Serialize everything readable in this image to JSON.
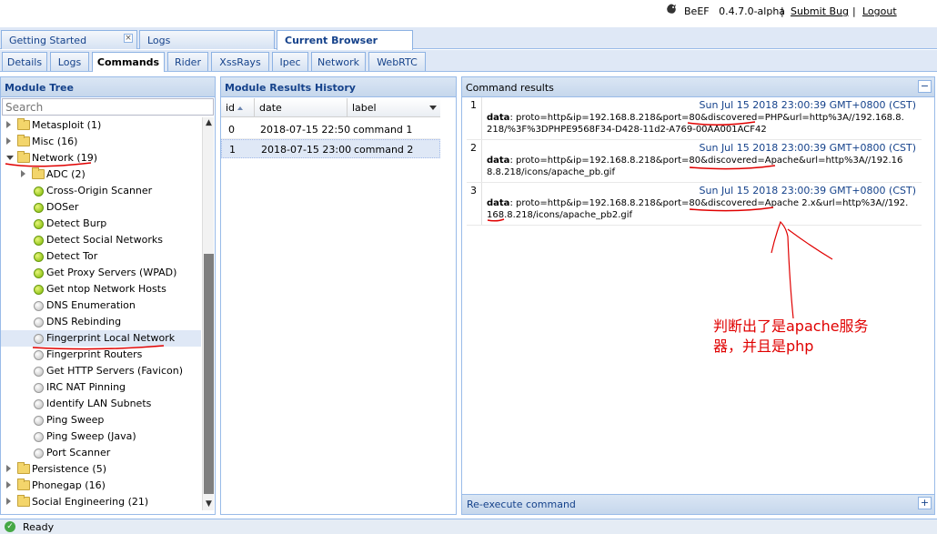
{
  "header": {
    "brand": "BeEF",
    "version": "0.4.7.0-alpha",
    "separator": "|",
    "submit_bug": "Submit  Bug",
    "logout": "Logout"
  },
  "main_tabs": [
    {
      "label": "Getting Started",
      "closable": true
    },
    {
      "label": "Logs"
    },
    {
      "label": "Current Browser",
      "active": true
    }
  ],
  "sub_tabs": [
    {
      "label": "Details"
    },
    {
      "label": "Logs"
    },
    {
      "label": "Commands",
      "active": true
    },
    {
      "label": "Rider"
    },
    {
      "label": "XssRays"
    },
    {
      "label": "Ipec"
    },
    {
      "label": "Network"
    },
    {
      "label": "WebRTC"
    }
  ],
  "module_tree": {
    "title": "Module Tree",
    "search_placeholder": "Search",
    "nodes": [
      {
        "label": "Metasploit (1)",
        "type": "folder",
        "level": 0
      },
      {
        "label": "Misc (16)",
        "type": "folder",
        "level": 0
      },
      {
        "label": "Network (19)",
        "type": "folder",
        "level": 0,
        "expanded": true
      },
      {
        "label": "ADC (2)",
        "type": "folder",
        "level": 1
      },
      {
        "label": "Cross-Origin Scanner",
        "type": "module",
        "status": "green",
        "level": 2
      },
      {
        "label": "DOSer",
        "type": "module",
        "status": "green",
        "level": 2
      },
      {
        "label": "Detect Burp",
        "type": "module",
        "status": "green",
        "level": 2
      },
      {
        "label": "Detect Social Networks",
        "type": "module",
        "status": "green",
        "level": 2
      },
      {
        "label": "Detect Tor",
        "type": "module",
        "status": "green",
        "level": 2
      },
      {
        "label": "Get Proxy Servers (WPAD)",
        "type": "module",
        "status": "green",
        "level": 2
      },
      {
        "label": "Get ntop Network Hosts",
        "type": "module",
        "status": "green",
        "level": 2
      },
      {
        "label": "DNS Enumeration",
        "type": "module",
        "status": "grey",
        "level": 2
      },
      {
        "label": "DNS Rebinding",
        "type": "module",
        "status": "grey",
        "level": 2
      },
      {
        "label": "Fingerprint Local Network",
        "type": "module",
        "status": "grey",
        "level": 2,
        "selected": true
      },
      {
        "label": "Fingerprint Routers",
        "type": "module",
        "status": "grey",
        "level": 2
      },
      {
        "label": "Get HTTP Servers (Favicon)",
        "type": "module",
        "status": "grey",
        "level": 2
      },
      {
        "label": "IRC NAT Pinning",
        "type": "module",
        "status": "grey",
        "level": 2
      },
      {
        "label": "Identify LAN Subnets",
        "type": "module",
        "status": "grey",
        "level": 2
      },
      {
        "label": "Ping Sweep",
        "type": "module",
        "status": "grey",
        "level": 2
      },
      {
        "label": "Ping Sweep (Java)",
        "type": "module",
        "status": "grey",
        "level": 2
      },
      {
        "label": "Port Scanner",
        "type": "module",
        "status": "grey",
        "level": 2
      },
      {
        "label": "Persistence (5)",
        "type": "folder",
        "level": 0
      },
      {
        "label": "Phonegap (16)",
        "type": "folder",
        "level": 0
      },
      {
        "label": "Social Engineering (21)",
        "type": "folder",
        "level": 0
      }
    ]
  },
  "results_history": {
    "title": "Module Results History",
    "columns": [
      "id",
      "date",
      "label"
    ],
    "rows": [
      {
        "id": "0",
        "date": "2018-07-15 22:50",
        "label": "command 1"
      },
      {
        "id": "1",
        "date": "2018-07-15 23:00",
        "label": "command 2",
        "selected": true
      }
    ]
  },
  "command_results": {
    "title": "Command results",
    "collapse_symbol": "−",
    "results": [
      {
        "num": "1",
        "time": "Sun Jul 15 2018 23:00:39 GMT+0800 (CST)",
        "key": "data",
        "value": ": proto=http&ip=192.168.8.218&port=80&discovered=PHP&url=http%3A//192.168.8.218/%3F%3DPHPE9568F34-D428-11d2-A769-00AA001ACF42"
      },
      {
        "num": "2",
        "time": "Sun Jul 15 2018 23:00:39 GMT+0800 (CST)",
        "key": "data",
        "value": ": proto=http&ip=192.168.8.218&port=80&discovered=Apache&url=http%3A//192.168.8.218/icons/apache_pb.gif"
      },
      {
        "num": "3",
        "time": "Sun Jul 15 2018 23:00:39 GMT+0800 (CST)",
        "key": "data",
        "value": ": proto=http&ip=192.168.8.218&port=80&discovered=Apache 2.x&url=http%3A//192.168.8.218/icons/apache_pb2.gif"
      }
    ],
    "footer": "Re-execute command",
    "expand_symbol": "+"
  },
  "annotation": {
    "line1": "判断出了是apache服务",
    "line2": "器，并且是php"
  },
  "status": {
    "text": "Ready"
  },
  "colors": {
    "accent": "#15428b",
    "panel_border": "#99bbe8",
    "annotation_red": "#e00000"
  }
}
